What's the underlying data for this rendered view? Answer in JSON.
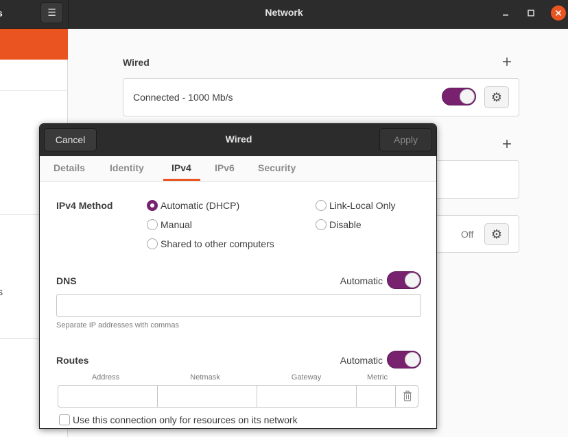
{
  "window": {
    "sidebar_title": "s",
    "title": "Network",
    "menu_icon": "hamburger-icon",
    "minimize_icon": "minimize-icon",
    "maximize_icon": "maximize-icon",
    "close_icon": "close-icon"
  },
  "sidebar": {
    "partial_item_label": "s",
    "accent_color": "#e95420"
  },
  "main": {
    "wired_label": "Wired",
    "wired_add_icon": "plus-icon",
    "connection_status": "Connected - 1000 Mb/s",
    "connection_toggle_on": true,
    "settings_icon": "gear-icon",
    "second_add_icon": "plus-icon",
    "proxy_status": "Off"
  },
  "dialog": {
    "cancel_label": "Cancel",
    "title": "Wired",
    "apply_label": "Apply",
    "tabs": [
      {
        "label": "Details",
        "active": false
      },
      {
        "label": "Identity",
        "active": false
      },
      {
        "label": "IPv4",
        "active": true
      },
      {
        "label": "IPv6",
        "active": false
      },
      {
        "label": "Security",
        "active": false
      }
    ],
    "ipv4": {
      "method_label": "IPv4 Method",
      "methods": [
        {
          "label": "Automatic (DHCP)",
          "selected": true
        },
        {
          "label": "Manual",
          "selected": false
        },
        {
          "label": "Shared to other computers",
          "selected": false
        },
        {
          "label": "Link-Local Only",
          "selected": false
        },
        {
          "label": "Disable",
          "selected": false
        }
      ],
      "dns_label": "DNS",
      "dns_automatic_label": "Automatic",
      "dns_automatic_on": true,
      "dns_value": "",
      "dns_hint": "Separate IP addresses with commas",
      "routes_label": "Routes",
      "routes_automatic_label": "Automatic",
      "routes_automatic_on": true,
      "routes_columns": [
        "Address",
        "Netmask",
        "Gateway",
        "Metric"
      ],
      "delete_icon": "trash-icon",
      "only_resources_label": "Use this connection only for resources on its network",
      "only_resources_checked": false
    }
  },
  "colors": {
    "accent": "#e95420",
    "toggle_on": "#77216f",
    "headerbar": "#2c2c2c"
  }
}
